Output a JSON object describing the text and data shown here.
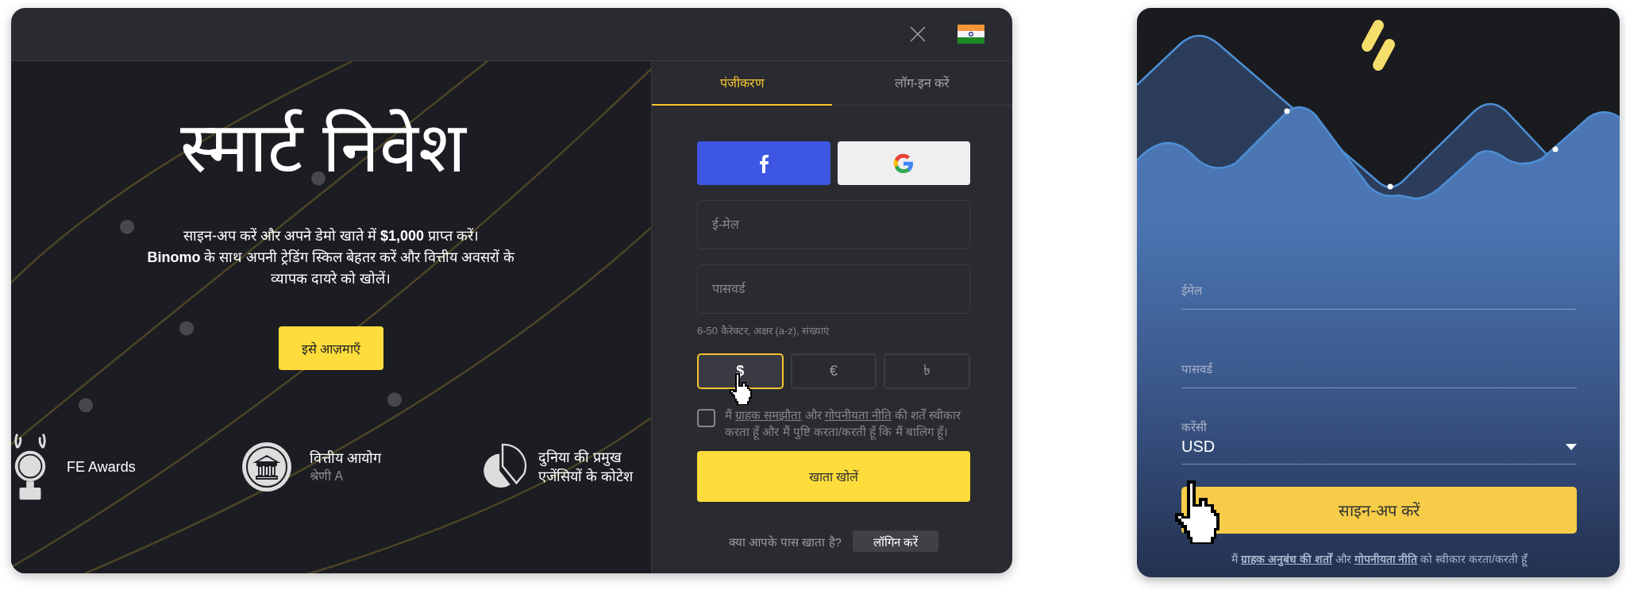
{
  "desktop": {
    "hero": {
      "title": "स्मार्ट निवेश",
      "text": "साइन-अप करें और अपने डेमो खाते में **$1,000** प्राप्त करें।\n**Binomo** के साथ अपनी ट्रेडिंग स्किल बेहतर करें और वित्तीय अवसरों के व्यापक दायरे को खोलें।",
      "button": "इसे आज़माएँ"
    },
    "features": [
      {
        "kind": "award",
        "lines": [
          "FE Awards"
        ]
      },
      {
        "kind": "bank",
        "lines": [
          "वित्तीय आयोग"
        ],
        "subtitle": "श्रेणी A"
      },
      {
        "kind": "chart",
        "lines": [
          "दुनिया की प्रमुख",
          "एजेंसियों के कोटेश"
        ]
      }
    ],
    "tabs": [
      {
        "label": "पंजीकरण",
        "selected": true
      },
      {
        "label": "लॉग-इन करें",
        "selected": false
      }
    ],
    "social": [
      {
        "kind": "facebook"
      },
      {
        "kind": "google"
      }
    ],
    "fields": [
      {
        "placeholder": "ई-मेल"
      },
      {
        "placeholder": "पासवर्ड"
      }
    ],
    "hint": "6-50 कैरेक्टर, अक्षर (a-z), संख्याएं",
    "currencies": [
      {
        "symbol": "$",
        "selected": true
      },
      {
        "symbol": "€",
        "selected": false
      },
      {
        "symbol": "৳",
        "selected": false
      }
    ],
    "agreement": {
      "checked": false,
      "parts": [
        {
          "kind": "text",
          "text": "मैं "
        },
        {
          "kind": "link",
          "text": "ग्राहक समझौता"
        },
        {
          "kind": "text",
          "text": " और "
        },
        {
          "kind": "link",
          "text": "गोपनीयता नीति"
        },
        {
          "kind": "text",
          "text": " की शर्तें स्वीकार करता हूँ और मैं पुष्टि करता/करती हूँ कि मैं बालिग हूँ।"
        }
      ]
    },
    "submit": "खाता खोलें",
    "login_prompt": "क्या आपके पास खाता है?",
    "login_button": "लॉगिन करें"
  },
  "mobile": {
    "fields": [
      {
        "kind": "text",
        "label": "ईमेल"
      },
      {
        "kind": "text",
        "label": "पासवर्ड"
      },
      {
        "kind": "select",
        "label": "करेंसी",
        "value": "USD"
      }
    ],
    "submit": "साइन-अप करें",
    "terms": [
      {
        "kind": "text",
        "text": "मैं "
      },
      {
        "kind": "link",
        "text": "ग्राहक अनुबंध की शर्तों"
      },
      {
        "kind": "text",
        "text": " और "
      },
      {
        "kind": "link",
        "text": "गोपनीयता नीति"
      },
      {
        "kind": "text",
        "text": " को स्वीकार करता/करती हूँ"
      }
    ]
  }
}
